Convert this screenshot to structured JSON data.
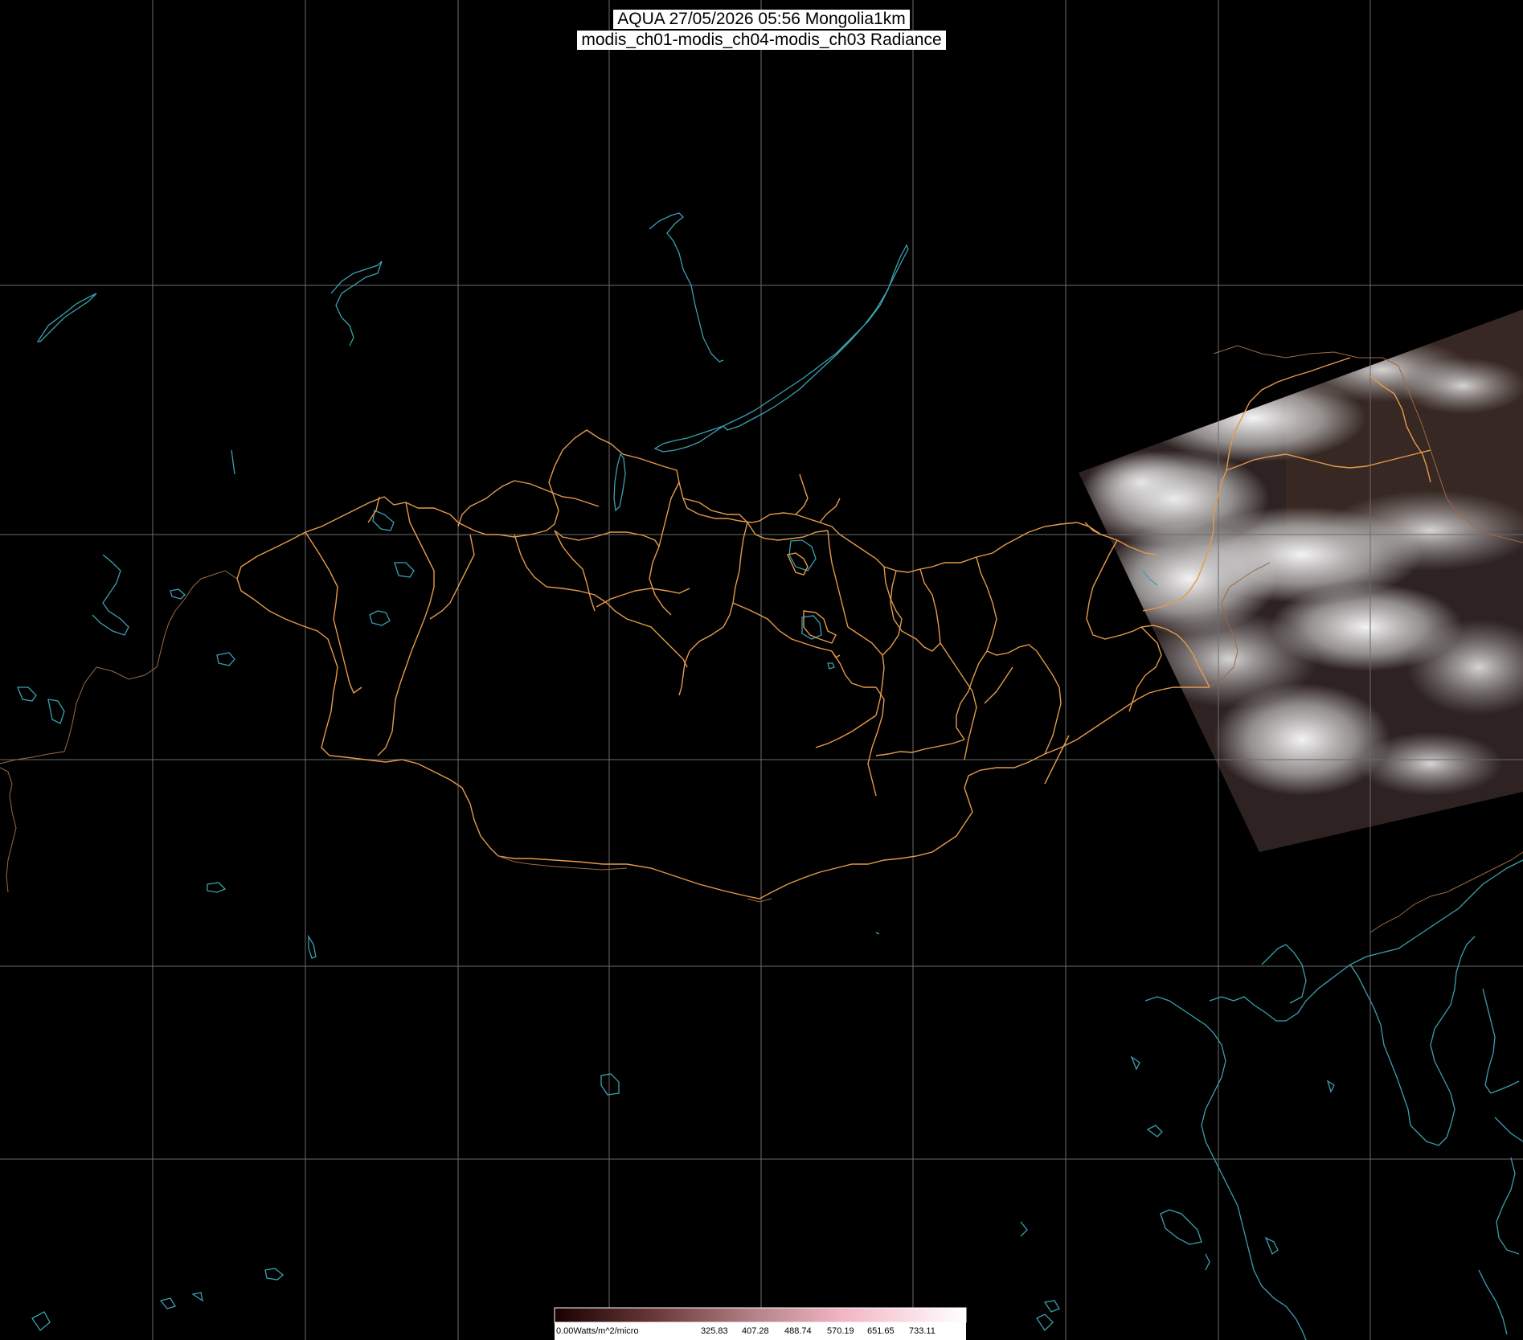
{
  "header": {
    "title_line1": "AQUA 27/05/2026 05:56 Mongolia1km",
    "title_line2": "modis_ch01-modis_ch04-modis_ch03 Radiance"
  },
  "legend": {
    "unit_label": "0.00Watts/m^2/micro",
    "tick_values": [
      "325.83",
      "407.28",
      "488.74",
      "570.19",
      "651.65",
      "733.11"
    ],
    "gradient_colors": [
      "#1a0000",
      "#6b3a3a",
      "#b8868c",
      "#f2b5c4",
      "#ffffff"
    ]
  },
  "map": {
    "graticule_color": "#6b6b6b",
    "border_color": "#e59a4a",
    "coast_color": "#3aa0b0",
    "satellite_swath": "cloudy swath over eastern Mongolia and northeast China"
  }
}
